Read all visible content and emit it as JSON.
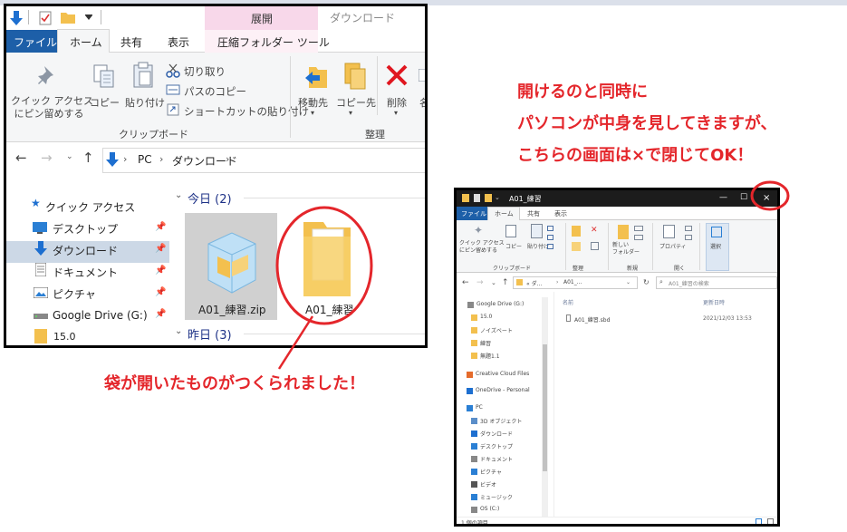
{
  "explorer1": {
    "ribbon_tabs": [
      "ファイル",
      "ホーム",
      "共有",
      "表示"
    ],
    "context_tab_group": "展開",
    "context_tab": "圧縮フォルダー ツール",
    "title_fragment": "ダウンロード",
    "ribbon": {
      "quick_access": "クイック アクセス\nにピン留めする",
      "copy": "コピー",
      "paste": "貼り付け",
      "cut": "切り取り",
      "copy_path": "パスのコピー",
      "paste_shortcut": "ショートカットの貼り付け",
      "clipboard_group": "クリップボード",
      "move_to": "移動先",
      "copy_to": "コピー先",
      "delete": "削除",
      "rename_partial": "名",
      "organize_group": "整理"
    },
    "address": {
      "pc": "PC",
      "folder": "ダウンロード"
    },
    "nav": [
      "クイック アクセス",
      "デスクトップ",
      "ダウンロード",
      "ドキュメント",
      "ピクチャ",
      "Google Drive (G:)",
      "15.0"
    ],
    "groups": {
      "today": "今日 (2)",
      "yesterday": "昨日 (3)"
    },
    "files": [
      "A01_練習.zip",
      "A01_練習"
    ]
  },
  "callout_top": [
    "開けるのと同時に",
    "パソコンが中身を見してきますが、",
    "こちらの画面は×で閉じてOK！"
  ],
  "callout_bottom": "袋が開いたものがつくられました！",
  "explorer2": {
    "title": "A01_練習",
    "tabs": [
      "ファイル",
      "ホーム",
      "共有",
      "表示"
    ],
    "ribbon_groups": [
      "クリップボード",
      "整理",
      "新規",
      "開く"
    ],
    "ribbon_labels": [
      "クイック アクセス\nにピン留めする",
      "コピー",
      "貼り付け",
      "新しい\nフォルダー",
      "プロパティ",
      "選択"
    ],
    "address": [
      "« ダ...",
      "A01_..."
    ],
    "search_placeholder": "A01_練習の検索",
    "columns": [
      "名前",
      "更新日時"
    ],
    "file": {
      "name": "A01_練習.sbd",
      "date": "2021/12/03 13:53"
    },
    "nav": [
      "Google Drive (G:)",
      "15.0",
      "ノイズベート",
      "練習",
      "無題1.1",
      "Creative Cloud Files",
      "OneDrive - Personal",
      "PC",
      "3D オブジェクト",
      "ダウンロード",
      "デスクトップ",
      "ドキュメント",
      "ピクチャ",
      "ビデオ",
      "ミュージック",
      "OS (C:)"
    ],
    "status": "1 個の項目",
    "close_glyph": "×"
  },
  "colors": {
    "accent": "#1d5fa8",
    "callout": "#e4262b",
    "context": "#f8d8ea",
    "folder": "#f3c04e"
  }
}
